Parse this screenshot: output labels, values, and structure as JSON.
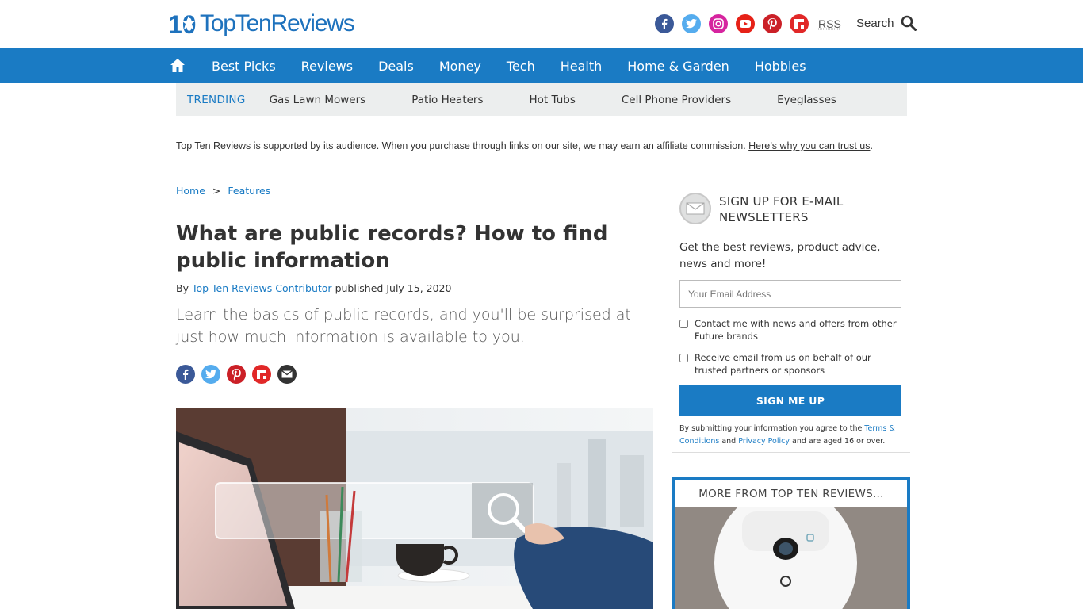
{
  "brand": {
    "logo_text": "TopTenReviews",
    "logo_number": "10",
    "accent": "#1a7bc4"
  },
  "header": {
    "socials": [
      {
        "name": "facebook",
        "color": "#3b5998"
      },
      {
        "name": "twitter",
        "color": "#55acee"
      },
      {
        "name": "instagram",
        "color": "#d6249f"
      },
      {
        "name": "youtube",
        "color": "#e62117"
      },
      {
        "name": "pinterest",
        "color": "#cb2027"
      },
      {
        "name": "flipboard",
        "color": "#e12828"
      }
    ],
    "rss_label": "RSS",
    "search_label": "Search"
  },
  "nav": {
    "items": [
      "Best Picks",
      "Reviews",
      "Deals",
      "Money",
      "Tech",
      "Health",
      "Home & Garden",
      "Hobbies"
    ]
  },
  "trending": {
    "label": "TRENDING",
    "items": [
      "Gas Lawn Mowers",
      "Patio Heaters",
      "Hot Tubs",
      "Cell Phone Providers",
      "Eyeglasses"
    ]
  },
  "affiliate": {
    "text": "Top Ten Reviews is supported by its audience. When you purchase through links on our site, we may earn an affiliate commission.",
    "link": "Here’s why you can trust us",
    "end": "."
  },
  "breadcrumb": {
    "home": "Home",
    "separator": ">",
    "section": "Features"
  },
  "article": {
    "title": "What are public records? How to find public information",
    "by": "By",
    "author": "Top Ten Reviews Contributor",
    "published": "published July 15, 2020",
    "strapline": "Learn the basics of public records, and you'll be surprised at just how much information is available to you."
  },
  "share": [
    {
      "name": "facebook",
      "color": "#3b5998"
    },
    {
      "name": "twitter",
      "color": "#55acee"
    },
    {
      "name": "pinterest",
      "color": "#cb2027"
    },
    {
      "name": "flipboard",
      "color": "#e12828"
    },
    {
      "name": "email",
      "color": "#333333"
    }
  ],
  "newsletter": {
    "title": "SIGN UP FOR E-MAIL NEWSLETTERS",
    "description": "Get the best reviews, product advice, news and more!",
    "email_placeholder": "Your Email Address",
    "check1": "Contact me with news and offers from other Future brands",
    "check2": "Receive email from us on behalf of our trusted partners or sponsors",
    "button": "SIGN ME UP",
    "fine_pre": "By submitting your information you agree to the",
    "terms": "Terms & Conditions",
    "and": "and",
    "privacy": "Privacy Policy",
    "fine_post": "and are aged 16 or over."
  },
  "more": {
    "title": "MORE FROM TOP TEN REVIEWS..."
  }
}
